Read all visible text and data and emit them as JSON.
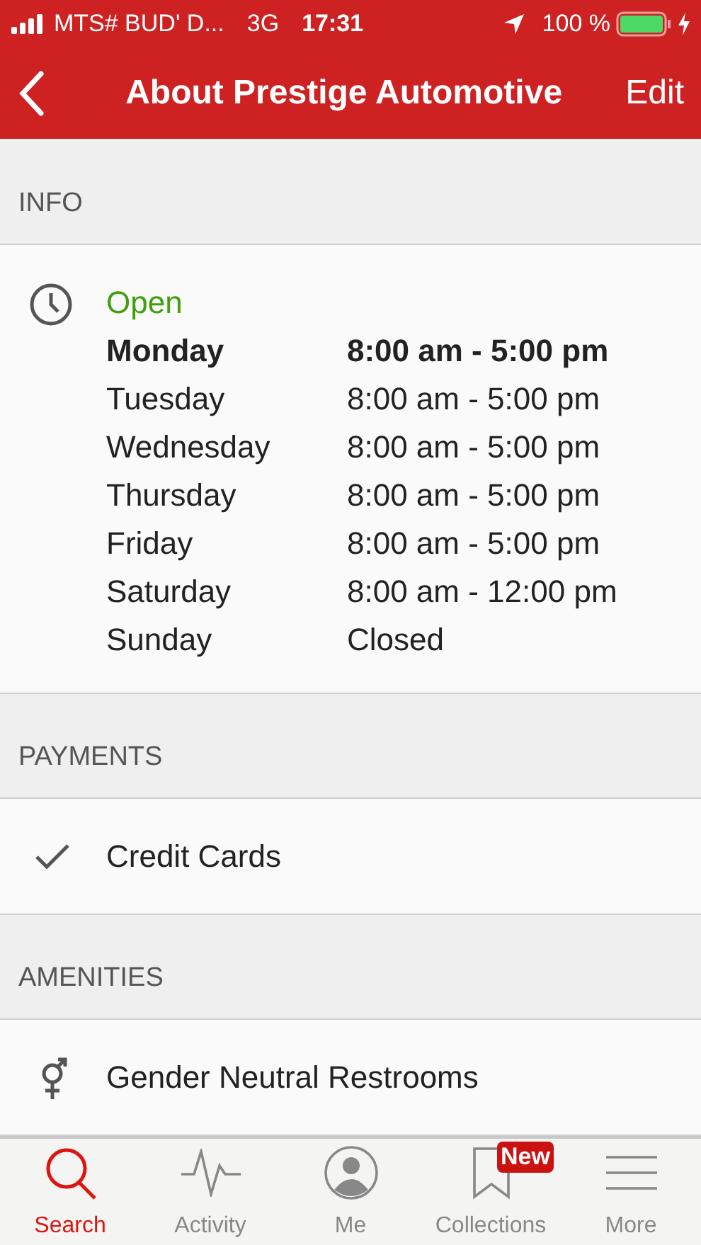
{
  "status_bar": {
    "carrier": "MTS# BUD' D...",
    "network": "3G",
    "time": "17:31",
    "battery": "100 %"
  },
  "nav": {
    "title": "About Prestige Automotive",
    "action": "Edit"
  },
  "info": {
    "header": "INFO",
    "status": "Open",
    "hours": [
      {
        "day": "Monday",
        "time": "8:00 am - 5:00 pm",
        "today": true
      },
      {
        "day": "Tuesday",
        "time": "8:00 am - 5:00 pm",
        "today": false
      },
      {
        "day": "Wednesday",
        "time": "8:00 am - 5:00 pm",
        "today": false
      },
      {
        "day": "Thursday",
        "time": "8:00 am - 5:00 pm",
        "today": false
      },
      {
        "day": "Friday",
        "time": "8:00 am - 5:00 pm",
        "today": false
      },
      {
        "day": "Saturday",
        "time": "8:00 am - 12:00 pm",
        "today": false
      },
      {
        "day": "Sunday",
        "time": "Closed",
        "today": false
      }
    ]
  },
  "sections": [
    {
      "header": "PAYMENTS",
      "items": [
        {
          "label": "Credit Cards",
          "kind": "check"
        }
      ]
    },
    {
      "header": "AMENITIES",
      "items": [
        {
          "label": "Gender Neutral Restrooms",
          "kind": "gender"
        }
      ]
    }
  ],
  "tab_bar": [
    {
      "label": "Search",
      "kind": "search",
      "selected": true
    },
    {
      "label": "Activity",
      "kind": "activity",
      "selected": false
    },
    {
      "label": "Me",
      "kind": "me",
      "selected": false
    },
    {
      "label": "Collections",
      "kind": "collections",
      "selected": false,
      "badge": "New"
    },
    {
      "label": "More",
      "kind": "more",
      "selected": false
    }
  ]
}
